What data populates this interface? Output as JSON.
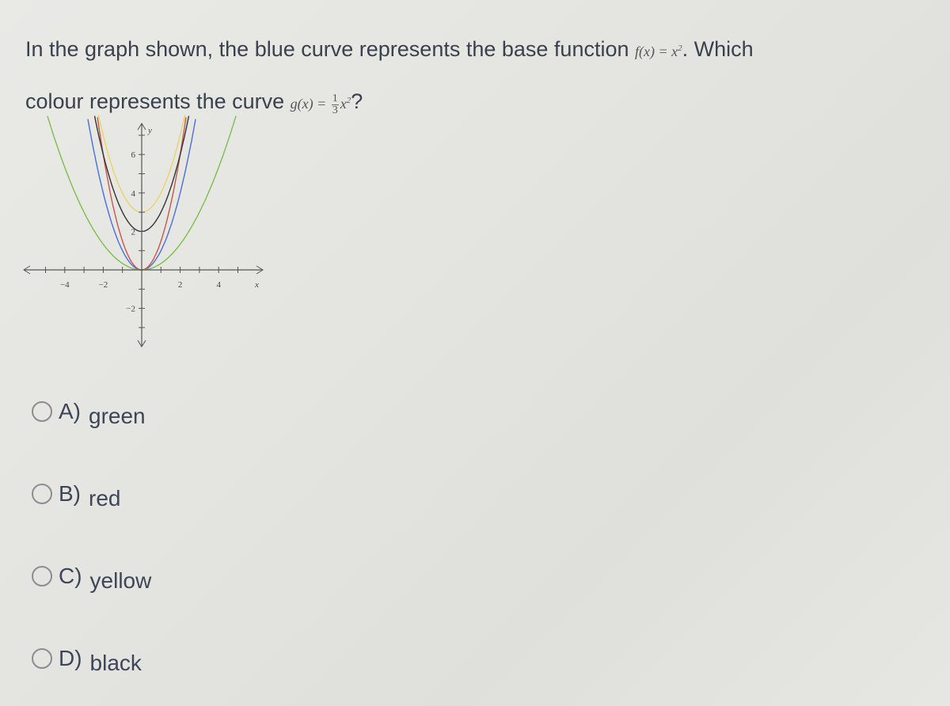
{
  "question": {
    "part1": "In the graph shown, the blue curve represents the base function ",
    "f_lhs": "f(x) = x",
    "f_exp": "2",
    "part2": ". Which",
    "part3": "colour represents the curve ",
    "g_lhs": "g(x) =",
    "g_num": "1",
    "g_den": "3",
    "g_var": "x",
    "g_exp": "2",
    "part4": "?"
  },
  "chart_data": {
    "type": "line",
    "title": "",
    "xlabel": "x",
    "ylabel": "y",
    "xlim": [
      -6,
      6
    ],
    "ylim": [
      -4,
      8
    ],
    "x_ticks": [
      -4,
      -2,
      2,
      4
    ],
    "y_ticks": [
      -2,
      2,
      4,
      6
    ],
    "grid": false,
    "series": [
      {
        "name": "blue",
        "color": "#4a6fd8",
        "a": 1,
        "k": 0
      },
      {
        "name": "red",
        "color": "#c8564a",
        "a": 1.5,
        "k": 0
      },
      {
        "name": "green",
        "color": "#7cbf4a",
        "a": 0.3333,
        "k": 0
      },
      {
        "name": "black",
        "color": "#333333",
        "a": 1,
        "k": 2
      },
      {
        "name": "yellow",
        "color": "#e8d46a",
        "a": 1,
        "k": 3
      }
    ]
  },
  "options": [
    {
      "letter": "A)",
      "text": "green"
    },
    {
      "letter": "B)",
      "text": "red"
    },
    {
      "letter": "C)",
      "text": "yellow"
    },
    {
      "letter": "D)",
      "text": "black"
    }
  ]
}
